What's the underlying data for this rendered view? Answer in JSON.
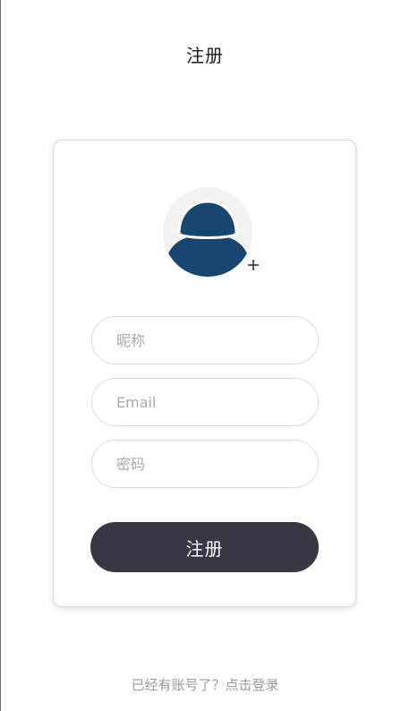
{
  "header": {
    "title": "注册"
  },
  "form": {
    "avatar_icon": "user-avatar-icon",
    "add_avatar_icon": "plus-icon",
    "nickname": {
      "value": "",
      "placeholder": "昵称"
    },
    "email": {
      "value": "",
      "placeholder": "Email"
    },
    "password": {
      "value": "",
      "placeholder": "密码"
    },
    "submit_label": "注册"
  },
  "footer": {
    "login_link": "已经有账号了？点击登录"
  },
  "colors": {
    "avatar": "#184670",
    "button": "#373843",
    "background": "#ffffff",
    "link": "#9a9a9a"
  }
}
